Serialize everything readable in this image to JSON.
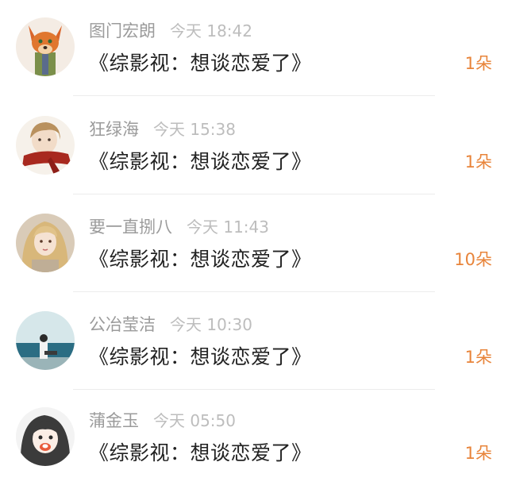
{
  "records": [
    {
      "name": "图门宏朗",
      "time": "今天 18:42",
      "title": "《综影视：想谈恋爱了》",
      "gift": "1朵",
      "avatar": "fox-avatar-icon"
    },
    {
      "name": "狂绿海",
      "time": "今天 15:38",
      "title": "《综影视：想谈恋爱了》",
      "gift": "1朵",
      "avatar": "scarf-boy-avatar-icon"
    },
    {
      "name": "要一直捌八",
      "time": "今天 11:43",
      "title": "《综影视：想谈恋爱了》",
      "gift": "10朵",
      "avatar": "blonde-girl-avatar-icon"
    },
    {
      "name": "公冶莹洁",
      "time": "今天 10:30",
      "title": "《综影视：想谈恋爱了》",
      "gift": "1朵",
      "avatar": "seaside-avatar-icon"
    },
    {
      "name": "蒲金玉",
      "time": "今天 05:50",
      "title": "《综影视：想谈恋爱了》",
      "gift": "1朵",
      "avatar": "anime-girl-avatar-icon"
    }
  ],
  "colors": {
    "gift": "#e8843a",
    "name": "#9b9b9b",
    "time": "#bdbdbd",
    "title": "#222222",
    "divider": "#ececec"
  }
}
